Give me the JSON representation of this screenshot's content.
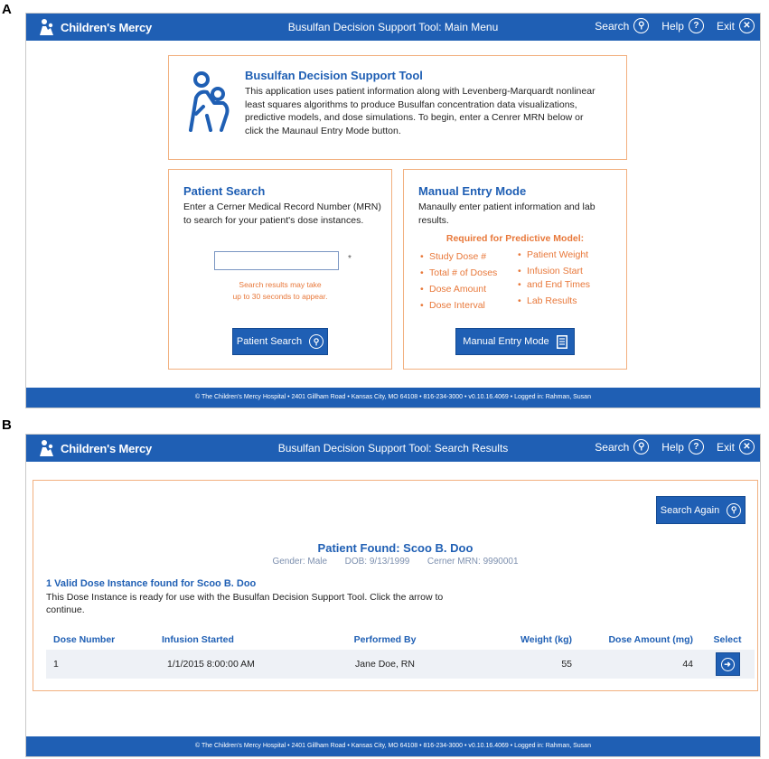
{
  "panel_a": {
    "letter": "A",
    "brand": "Children's Mercy",
    "title": "Busulfan Decision Support Tool: Main Menu",
    "nav": {
      "search": "Search",
      "help": "Help",
      "exit": "Exit"
    },
    "intro": {
      "title": "Busulfan Decision Support Tool",
      "text": "This application uses patient information along with Levenberg-Marquardt nonlinear least squares algorithms to produce Busulfan concentration data visualizations, predictive models, and dose simulations. To begin, enter a Cenrer MRN below or click the Maunaul Entry Mode button."
    },
    "patient_search": {
      "title": "Patient Search",
      "text": "Enter a Cerner Medical Record Number (MRN) to search for your patient's dose instances.",
      "input_value": "",
      "required_mark": "*",
      "hint_line1": "Search results may take",
      "hint_line2": "up to 30 seconds to appear.",
      "button_label": "Patient Search"
    },
    "manual_entry": {
      "title": "Manual Entry Mode",
      "text": "Manaully enter patient information and lab results.",
      "required_title": "Required for Predictive Model:",
      "left_items": [
        "Study Dose #",
        "Total # of Doses",
        "Dose Amount",
        "Dose Interval"
      ],
      "right_items": [
        "Patient Weight",
        "Infusion Start",
        "and End Times",
        "Lab Results"
      ],
      "button_label": "Manual Entry Mode"
    },
    "footer": "© The Children's Mercy Hospital   •   2401 Gillham Road   •   Kansas City, MO 64108   •   816-234-3000   •   v0.10.16.4069   •   Logged in: Rahman, Susan"
  },
  "panel_b": {
    "letter": "B",
    "brand": "Children's Mercy",
    "title": "Busulfan Decision Support Tool: Search Results",
    "nav": {
      "search": "Search",
      "help": "Help",
      "exit": "Exit"
    },
    "search_again_label": "Search Again",
    "patient": {
      "found_label": "Patient Found: Scoo B. Doo",
      "gender": "Gender: Male",
      "dob": "DOB: 9/13/1999",
      "mrn": "Cerner MRN: 9990001"
    },
    "dose_heading": "1 Valid Dose Instance found for Scoo B. Doo",
    "dose_text": "This Dose Instance is ready for use with the Busulfan Decision Support Tool. Click the arrow to continue.",
    "table": {
      "headers": [
        "Dose Number",
        "Infusion Started",
        "Performed By",
        "Weight (kg)",
        "Dose Amount (mg)",
        "Select"
      ],
      "rows": [
        {
          "dose_number": "1",
          "infusion_started": "1/1/2015 8:00:00 AM",
          "performed_by": "Jane Doe, RN",
          "weight": "55",
          "dose_amount": "44"
        }
      ]
    },
    "footer": "© The Children's Mercy Hospital   •   2401 Gillham Road   •   Kansas City, MO 64108   •   816-234-3000   •   v0.10.16.4069   •   Logged in: Rahman, Susan"
  },
  "colors": {
    "brand_blue": "#1f5fb4",
    "accent_orange": "#e8783a",
    "border_orange": "#f2b07f"
  },
  "icons": {
    "search": "search-icon",
    "help": "help-icon",
    "exit": "close-icon",
    "manual": "document-icon",
    "select": "arrow-right-icon",
    "logo": "logo-icon",
    "app": "caregiver-child-icon"
  }
}
